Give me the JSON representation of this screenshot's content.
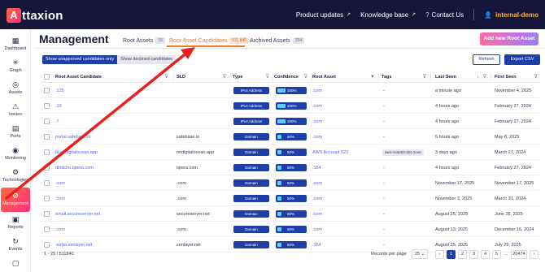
{
  "app": {
    "logo_letter": "A",
    "logo_text": "ttaxion"
  },
  "topnav": [
    {
      "label": "Product updates",
      "ext": "↗"
    },
    {
      "label": "Knowledge base",
      "ext": "↗"
    },
    {
      "label": "Contact Us",
      "icon": "?"
    }
  ],
  "user": {
    "label": "internal-demo",
    "icon": "👤"
  },
  "sidebar": [
    {
      "label": "Dashboard",
      "icon": "▦"
    },
    {
      "label": "Graph",
      "icon": "✳"
    },
    {
      "label": "Assets",
      "icon": "◎"
    },
    {
      "label": "Issues",
      "icon": "⚠"
    },
    {
      "label": "Ports",
      "icon": "▤"
    },
    {
      "label": "Monitoring",
      "icon": "◉"
    },
    {
      "label": "Technologies",
      "icon": "⚙"
    },
    {
      "label": "Management",
      "icon": "⚙"
    },
    {
      "label": "Reports",
      "icon": "▣"
    },
    {
      "label": "Events",
      "icon": "↻"
    },
    {
      "label": "",
      "icon": "▢"
    }
  ],
  "header": {
    "title": "Management",
    "tabs": [
      {
        "label": "Root Assets",
        "count": "15"
      },
      {
        "label": "Root Asset Candidates",
        "count": "511,840"
      },
      {
        "label": "Archived Assets",
        "count": "254"
      }
    ],
    "add_button": "Add new Root Asset"
  },
  "filters": {
    "unapproved": "Show unapproved candidates only",
    "declined": "Show declined candidates"
  },
  "actions": {
    "refresh": "Refresh",
    "export": "Export CSV"
  },
  "table": {
    "columns": [
      "Root Asset Candidate",
      "SLD",
      "Type",
      "Confidence",
      "Root Asset",
      "Tags",
      "Last Seen",
      "First Seen"
    ],
    "rows": [
      {
        "candidate": ".125",
        "sld": "",
        "type": "IPv4 Address",
        "confidence": 100,
        "conf_label": "100%",
        "root_asset": ".com",
        "tags": "-",
        "last_seen": "a minute ago",
        "first_seen": "November 4, 2025"
      },
      {
        "candidate": ".10",
        "sld": "",
        "type": "IPv4 Address",
        "confidence": 100,
        "conf_label": "100%",
        "root_asset": ".com",
        "tags": "-",
        "last_seen": "4 hours ago",
        "first_seen": "February 27, 2024"
      },
      {
        "candidate": ".7",
        "sld": "",
        "type": "IPv4 Address",
        "confidence": 100,
        "conf_label": "100%",
        "root_asset": ".com",
        "tags": "-",
        "last_seen": "4 hours ago",
        "first_seen": "February 27, 2024"
      },
      {
        "candidate": "portal.safebase.io",
        "sld": "safebase.io",
        "type": "Domain",
        "confidence": 50,
        "conf_label": "50%",
        "root_asset": ".com",
        "tags": "-",
        "last_seen": "5 hours ago",
        "first_seen": "May 8, 2025"
      },
      {
        "candidate": "bl.ondigitalocean.app",
        "sld": "ondigitalocean.app",
        "type": "Domain",
        "confidence": 50,
        "conf_label": "50%",
        "root_asset": "AWS Account 523",
        "tags": "aws-route53-dns-zone",
        "last_seen": "3 days ago",
        "first_seen": "March 27, 2024"
      },
      {
        "candidate": "dinacho.opera.com",
        "sld": "opera.com",
        "type": "Domain",
        "confidence": 50,
        "conf_label": "50%",
        "root_asset": ".154",
        "tags": "-",
        "last_seen": "4 hours ago",
        "first_seen": "February 27, 2024"
      },
      {
        "candidate": ".com",
        "sld": ".com",
        "type": "Domain",
        "confidence": 50,
        "conf_label": "50%",
        "root_asset": ".com",
        "tags": "-",
        "last_seen": "November 17, 2025",
        "first_seen": "November 17, 2025"
      },
      {
        "candidate": ".com",
        "sld": ".com",
        "type": "Domain",
        "confidence": 50,
        "conf_label": "50%",
        "root_asset": ".com",
        "tags": "-",
        "last_seen": "November 3, 2025",
        "first_seen": "March 31, 2024"
      },
      {
        "candidate": "email.secureserver.net",
        "sld": "secureserver.net",
        "type": "Domain",
        "confidence": 50,
        "conf_label": "50%",
        "root_asset": ".com",
        "tags": "-",
        "last_seen": "August 25, 2025",
        "first_seen": "June 26, 2025"
      },
      {
        "candidate": ".com",
        "sld": ".com",
        "type": "Domain",
        "confidence": 50,
        "conf_label": "50%",
        "root_asset": ".com",
        "tags": "-",
        "last_seen": "August 13, 2025",
        "first_seen": "December 16, 2024"
      },
      {
        "candidate": ".turbo.zenlayer.net",
        "sld": "zenlayer.net",
        "type": "Domain",
        "confidence": 50,
        "conf_label": "50%",
        "root_asset": ".154",
        "tags": "-",
        "last_seen": "August 25, 2025",
        "first_seen": "July 29, 2025"
      }
    ]
  },
  "pagination": {
    "range": "1 - 25 / 511840",
    "rows_per_page_label": "Records per page",
    "rows_per_page": "25 ⌄",
    "prev": "‹",
    "pages": [
      "1",
      "2",
      "3",
      "4",
      "5"
    ],
    "ellipsis": "...",
    "last": "20474",
    "next": "›"
  },
  "colors": {
    "accent": "#f07a2b",
    "primary": "#1f3fa8",
    "topbar": "#15163a",
    "annotation": "#e8211c"
  }
}
